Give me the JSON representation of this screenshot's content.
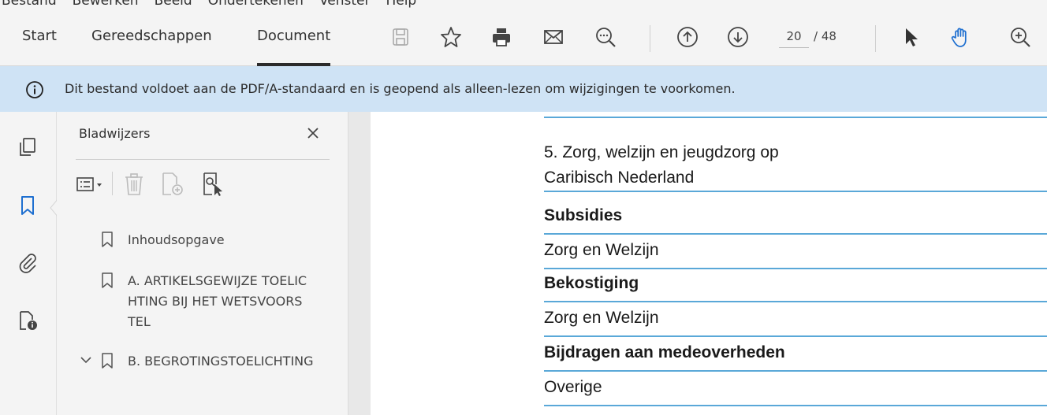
{
  "menubar": {
    "items": [
      "Bestand",
      "Bewerken",
      "Beeld",
      "Ondertekenen",
      "Venster",
      "Help"
    ]
  },
  "toolbar": {
    "tabs": [
      {
        "label": "Start",
        "active": false
      },
      {
        "label": "Gereedschappen",
        "active": false
      },
      {
        "label": "Document",
        "active": true
      }
    ],
    "icons": [
      "save-icon",
      "star-icon",
      "print-icon",
      "mail-icon",
      "search-icon",
      "page-up-icon",
      "page-down-icon",
      "select-cursor-icon",
      "hand-tool-icon",
      "zoom-in-icon"
    ],
    "page_current": "20",
    "page_separator": "/ 48"
  },
  "banner": {
    "icon": "info-icon",
    "message": "Dit bestand voldoet aan de PDF/A-standaard en is geopend als alleen-lezen om wijzigingen te voorkomen."
  },
  "rail": {
    "icons": [
      "pages-icon",
      "bookmark-icon",
      "attachment-icon",
      "security-icon"
    ]
  },
  "bookmarks_panel": {
    "title": "Bladwijzers",
    "tools": [
      "options-icon",
      "delete-icon",
      "new-bookmark-icon",
      "bookmark-search-icon"
    ],
    "items": [
      {
        "label": "Inhoudsopgave",
        "expandable": false
      },
      {
        "label": "A. ARTIKELSGEWIJZE TOELICHTING BIJ HET WETSVOORSTEL",
        "expandable": false
      },
      {
        "label": "B. BEGROTINGSTOELICHTING",
        "expandable": true,
        "expanded": true
      }
    ]
  },
  "document": {
    "rows": [
      {
        "text": "5. Zorg, welzijn en jeugdzorg op",
        "bold": false
      },
      {
        "text": "Caribisch Nederland",
        "bold": false
      },
      {
        "text": "Subsidies",
        "bold": true
      },
      {
        "text": "Zorg en Welzijn",
        "bold": false
      },
      {
        "text": "Bekostiging",
        "bold": true
      },
      {
        "text": "Zorg en Welzijn",
        "bold": false
      },
      {
        "text": "Bijdragen aan medeoverheden",
        "bold": true
      },
      {
        "text": "Overige",
        "bold": false
      }
    ]
  },
  "colors": {
    "banner_bg": "#cfe3f5",
    "rule_blue": "#5aa8d8",
    "chrome_bg": "#f4f4f4"
  }
}
